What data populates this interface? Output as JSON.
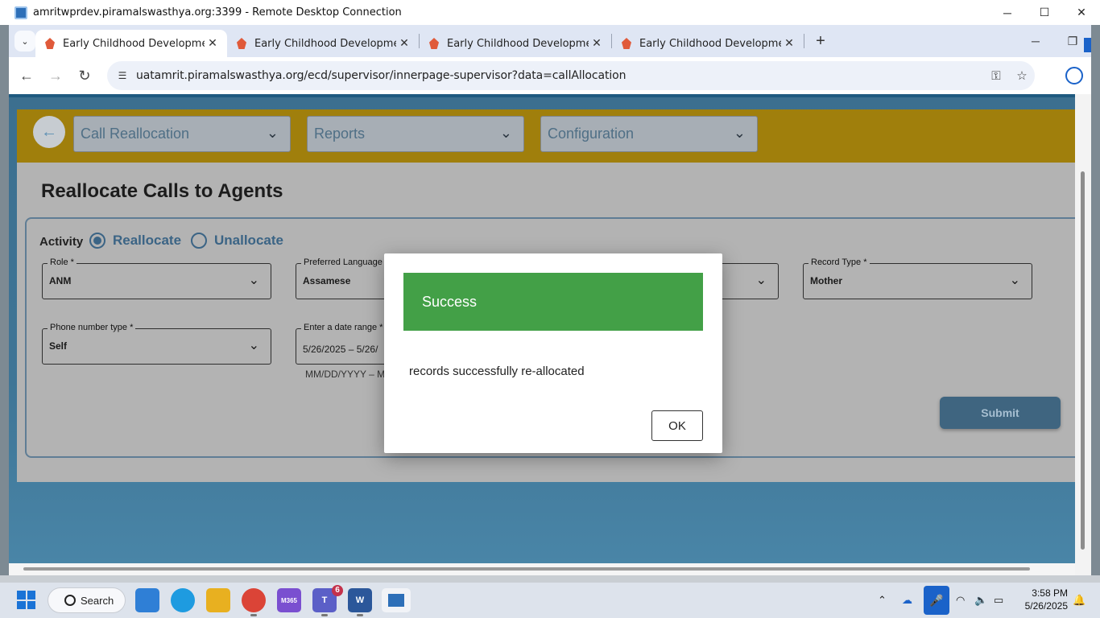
{
  "rdc": {
    "title": "amritwprdev.piramalswasthya.org:3399 - Remote Desktop Connection",
    "minimize": "─",
    "maximize": "☐",
    "close": "✕"
  },
  "browser": {
    "tabs": [
      {
        "label": "Early Childhood Development",
        "active": true
      },
      {
        "label": "Early Childhood Development",
        "active": false
      },
      {
        "label": "Early Childhood Development",
        "active": false
      },
      {
        "label": "Early Childhood Development",
        "active": false
      }
    ],
    "tab_menu": "⌄",
    "tab_close": "✕",
    "new_tab": "+",
    "url": "uatamrit.piramalswasthya.org/ecd/supervisor/innerpage-supervisor?data=callAllocation",
    "back": "←",
    "forward": "→",
    "reload": "↻",
    "key_icon": "⚿",
    "star_icon": "☆"
  },
  "app": {
    "back_icon": "←",
    "menus": [
      {
        "label": "Call Reallocation"
      },
      {
        "label": "Reports"
      },
      {
        "label": "Configuration"
      }
    ],
    "chevron": "⌄",
    "page_title": "Reallocate Calls to Agents",
    "activity": {
      "label": "Activity",
      "options": [
        {
          "label": "Reallocate",
          "selected": true
        },
        {
          "label": "Unallocate",
          "selected": false
        }
      ]
    },
    "fields": {
      "role": {
        "label": "Role *",
        "value": "ANM"
      },
      "preferred_language": {
        "label": "Preferred Language *",
        "value": "Assamese"
      },
      "record_type": {
        "label": "Record Type *",
        "value": "Mother"
      },
      "phone_number_type": {
        "label": "Phone number type *",
        "value": "Self"
      },
      "date_range": {
        "label": "Enter a date range *",
        "value": "5/26/2025 – 5/26/",
        "hint": "MM/DD/YYYY – M"
      }
    },
    "submit_label": "Submit"
  },
  "dialog": {
    "title": "Success",
    "message": "records successfully re-allocated",
    "ok_label": "OK"
  },
  "taskbar": {
    "search_label": "Search",
    "teams_badge": "6",
    "m365_label": "M365",
    "time": "3:58 PM",
    "date": "5/26/2025"
  },
  "colors": {
    "header_band": "#a07f0c",
    "success": "#43a047",
    "accent": "#1a62c9"
  }
}
